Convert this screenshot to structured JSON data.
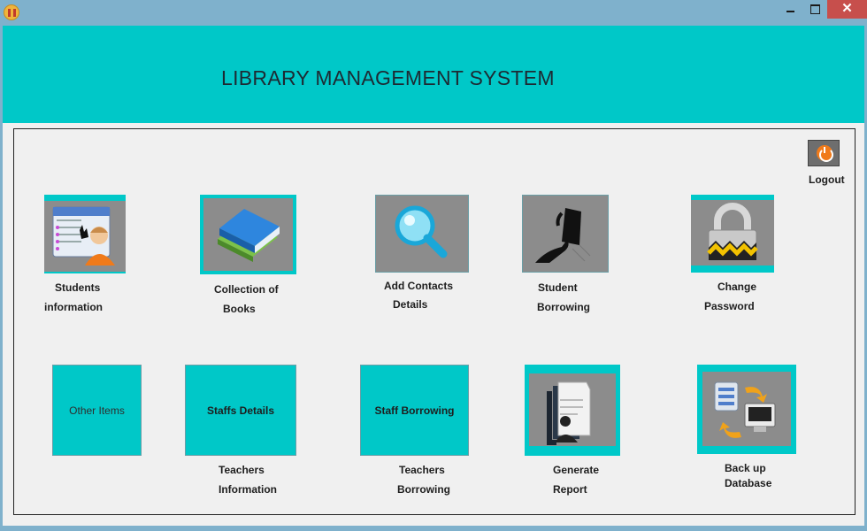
{
  "window": {
    "title": "",
    "close_glyph": "✕"
  },
  "header": {
    "title": "LIBRARY MANAGEMENT SYSTEM",
    "color": "#00c8c8"
  },
  "logout": {
    "label": "Logout",
    "icon": "power-icon"
  },
  "row1": [
    {
      "line1": "Students",
      "line2": "information",
      "icon": "student-card-icon"
    },
    {
      "line1": "Collection of",
      "line2": "Books",
      "icon": "books-icon"
    },
    {
      "line1": "Add Contacts",
      "line2": "Details",
      "icon": "magnifier-icon"
    },
    {
      "line1": "Student",
      "line2": "Borrowing",
      "icon": "handover-icon"
    },
    {
      "line1": "Change",
      "line2": "Password",
      "icon": "padlock-icon"
    }
  ],
  "row2": {
    "other_items": "Other Items",
    "staffs_details": "Staffs Details",
    "staff_borrowing": "Staff Borrowing",
    "teachers_info": {
      "line1": "Teachers",
      "line2": "Information"
    },
    "teachers_borrow": {
      "line1": "Teachers",
      "line2": "Borrowing"
    },
    "report": {
      "line1": "Generate",
      "line2": "Report",
      "icon": "report-icon"
    },
    "backup": {
      "line1": "Back up",
      "line2": "Database",
      "icon": "backup-icon"
    }
  }
}
